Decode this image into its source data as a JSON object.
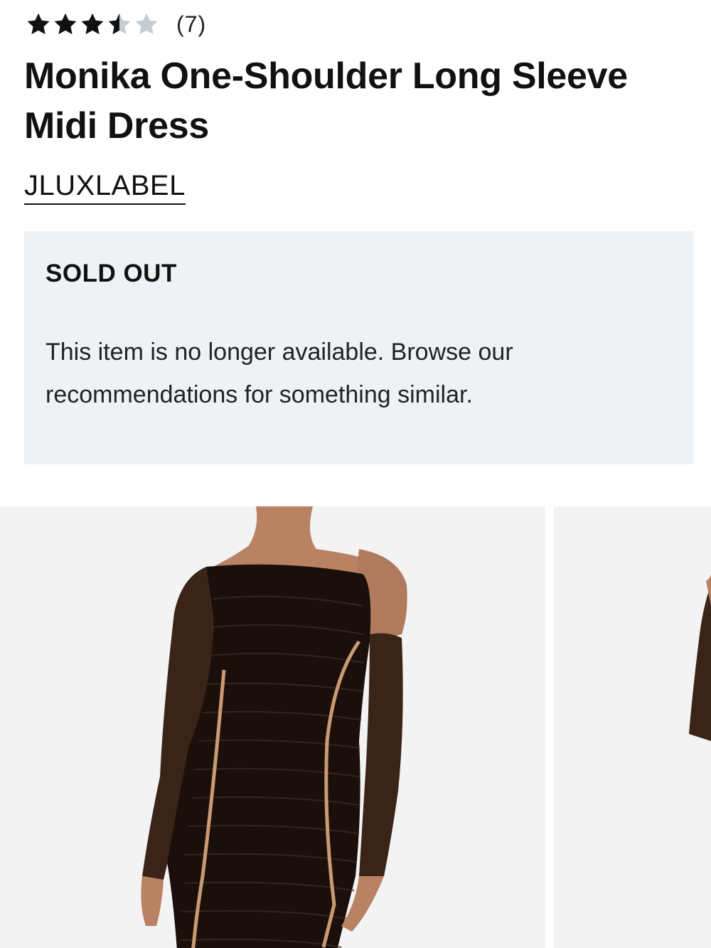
{
  "product": {
    "rating": 3.5,
    "rating_max": 5,
    "review_count": "(7)",
    "title": "Monika One-Shoulder Long Sleeve Midi Dress",
    "brand": "JLUXLABEL"
  },
  "availability": {
    "status": "SOLD OUT",
    "message": "This item is no longer available. Browse our recommendations for something similar."
  },
  "gallery": {
    "images": [
      "black-ruched-mesh-dress-front",
      "black-ruched-mesh-dress-alt"
    ]
  },
  "colors": {
    "star_filled": "#111111",
    "star_empty": "#c4ccd2",
    "notice_bg": "#eff2f5",
    "image_bg": "#f3f3f3"
  }
}
